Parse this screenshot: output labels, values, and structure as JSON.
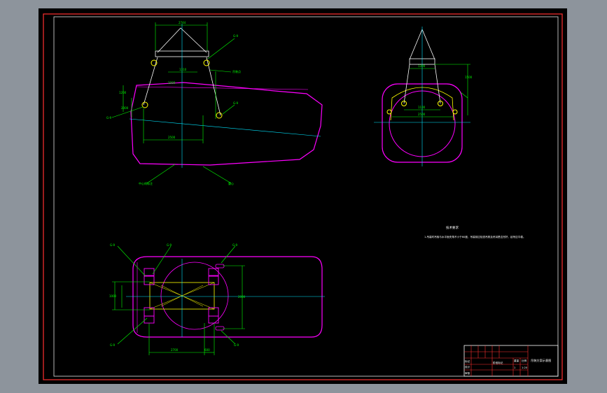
{
  "colors": {
    "frame_outer": "#e0e0e0",
    "frame_red": "#ff3030",
    "paper": "#000000",
    "magenta": "#ff00ff",
    "cyan": "#00e5ff",
    "yellow": "#ffff00",
    "green": "#00ff00",
    "white": "#ffffff"
  },
  "side_view": {
    "dims": {
      "top": "2744",
      "mid": "1310",
      "right_vert": "2000",
      "left_vert": "1200",
      "lower_left": "2000",
      "bottom": "2500"
    },
    "callouts": {
      "top_right": "G-9",
      "mid_right": "吊装点",
      "lower_right": "G-9",
      "left": "G-9",
      "bottom_left": "中心线标注",
      "bottom_right": "重心"
    }
  },
  "end_view": {
    "dims": {
      "top": "1300",
      "right": "1500",
      "mid": "1100",
      "lower": "2500"
    }
  },
  "plan_view": {
    "dims": {
      "left": "1000",
      "right": "2000",
      "bottom_left": "2700",
      "bottom_right": "600"
    },
    "callouts": {
      "tl1": "G-9",
      "tl2": "G-9",
      "tr": "G-9",
      "bl": "G-9",
      "br": "G-9"
    }
  },
  "notes": {
    "heading": "技术要求",
    "line": "1.吊装时吊索与水平面夹角不小于60度，吊装前应检查吊具及吊耳是否完好，起吊应平稳。"
  },
  "title_block": {
    "title": "吊装方案示意图",
    "scale": "1:20",
    "sheet": "1",
    "row_labels": [
      "标记",
      "设计",
      "审核",
      "工艺",
      "批准"
    ],
    "cells": [
      "处数",
      "分区",
      "签名",
      "年月日",
      "阶段标记",
      "重量",
      "比例"
    ]
  }
}
